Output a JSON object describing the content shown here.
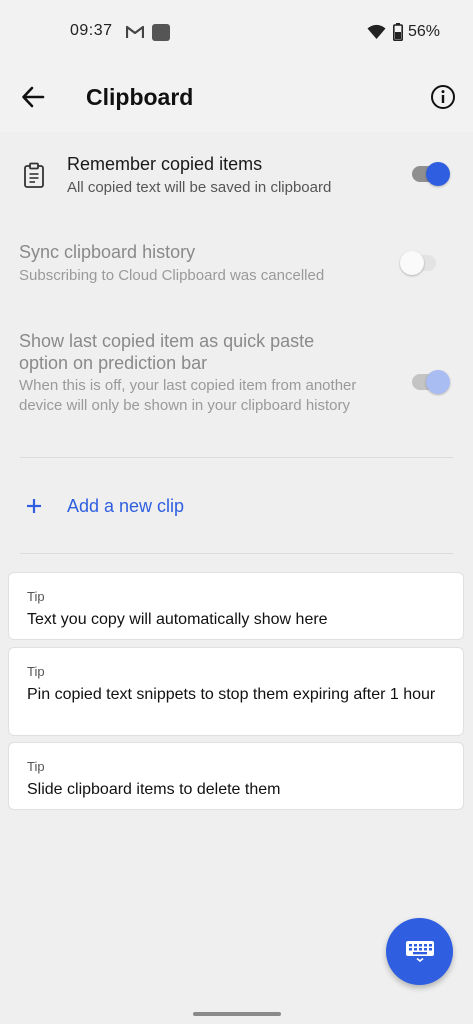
{
  "status_bar": {
    "time": "09:37",
    "battery": "56%",
    "icons": [
      "gmail-icon",
      "app-square-icon",
      "wifi-icon",
      "battery-icon"
    ]
  },
  "app_bar": {
    "title": "Clipboard",
    "icons": [
      "back-arrow-icon",
      "info-icon"
    ]
  },
  "settings": [
    {
      "title": "Remember copied items",
      "subtitle": "All copied text will be saved in clipboard",
      "icon": "clipboard-icon",
      "toggle": "on",
      "enabled": true
    },
    {
      "title": "Sync clipboard history",
      "subtitle": "Subscribing to Cloud Clipboard was cancelled",
      "toggle": "off",
      "enabled": false
    },
    {
      "title": "Show last copied item as quick paste option on prediction bar",
      "subtitle": "When this is off, your last copied item from another device will only be shown in your clipboard history",
      "toggle": "on",
      "enabled": false
    }
  ],
  "add_clip": {
    "label": "Add a new clip",
    "icon": "plus-icon"
  },
  "tips": [
    {
      "label": "Tip",
      "text": "Text you copy will automatically show here"
    },
    {
      "label": "Tip",
      "text": "Pin copied text snippets to stop them expiring after 1 hour"
    },
    {
      "label": "Tip",
      "text": "Slide clipboard items to delete them"
    }
  ],
  "fab": {
    "icon": "keyboard-icon"
  },
  "colors": {
    "accent": "#2f5fe0",
    "background": "#efefef",
    "card": "#ffffff"
  }
}
